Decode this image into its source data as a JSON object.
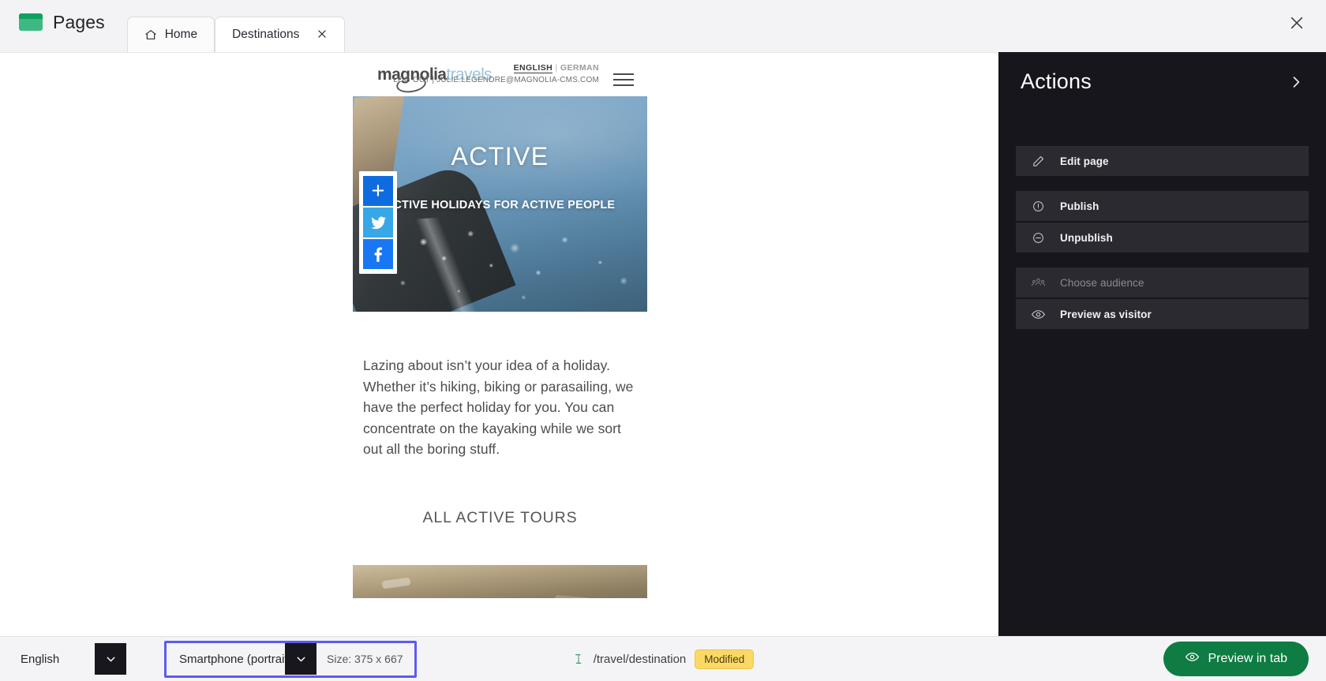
{
  "app": {
    "name": "Pages",
    "logo_icon": "pages-logo-icon",
    "window_close_icon": "close-icon"
  },
  "tabs": [
    {
      "label": "Home",
      "icon": "home-icon",
      "active": false,
      "closable": false
    },
    {
      "label": "Destinations",
      "icon": "",
      "active": true,
      "closable": true,
      "close_icon": "close-icon"
    }
  ],
  "preview": {
    "site": {
      "logo_primary": "magnolia",
      "logo_secondary": "travels",
      "lang_en": "ENGLISH",
      "lang_sep": "|",
      "lang_de": "GERMAN",
      "logout_line": "LOG OUT | JULIE.LEGENDRE@MAGNOLIA-CMS.COM",
      "menu_icon": "hamburger-menu-icon"
    },
    "hero": {
      "title": "ACTIVE",
      "subtitle": "ACTIVE HOLIDAYS FOR ACTIVE PEOPLE"
    },
    "share": [
      {
        "name": "addthis-share-icon",
        "glyph": "+"
      },
      {
        "name": "twitter-share-icon",
        "glyph": ""
      },
      {
        "name": "facebook-share-icon",
        "glyph": ""
      }
    ],
    "body_copy": "Lazing about isn’t your idea of a holiday. Whether it’s hiking, biking or parasailing, we have the perfect holiday for you. You can concentrate on the kayaking while we sort out all the boring stuff.",
    "section_heading": "ALL ACTIVE TOURS"
  },
  "actions": {
    "title": "Actions",
    "collapse_icon": "chevron-right-icon",
    "groups": [
      {
        "items": [
          {
            "label": "Edit page",
            "icon": "pencil-icon",
            "disabled": false
          }
        ]
      },
      {
        "items": [
          {
            "label": "Publish",
            "icon": "publish-icon",
            "disabled": false
          },
          {
            "label": "Unpublish",
            "icon": "unpublish-icon",
            "disabled": false
          }
        ]
      },
      {
        "items": [
          {
            "label": "Choose audience",
            "icon": "audience-icon",
            "disabled": true
          },
          {
            "label": "Preview as visitor",
            "icon": "eye-icon",
            "disabled": false
          }
        ]
      }
    ]
  },
  "statusbar": {
    "language": {
      "value": "English",
      "chevron_icon": "chevron-down-icon"
    },
    "device": {
      "value": "Smartphone (portrait)",
      "chevron_icon": "chevron-down-icon",
      "focused": true
    },
    "size_label": "Size: 375 x 667",
    "page_icon": "page-status-icon",
    "page_path": "/travel/destination",
    "status_badge": "Modified",
    "preview_button": {
      "label": "Preview in tab",
      "icon": "eye-icon"
    }
  },
  "colors": {
    "accent_green": "#0e7c43",
    "focus_blue": "#5b5bf5",
    "badge_yellow": "#fcd966",
    "panel_dark": "#17161c"
  }
}
